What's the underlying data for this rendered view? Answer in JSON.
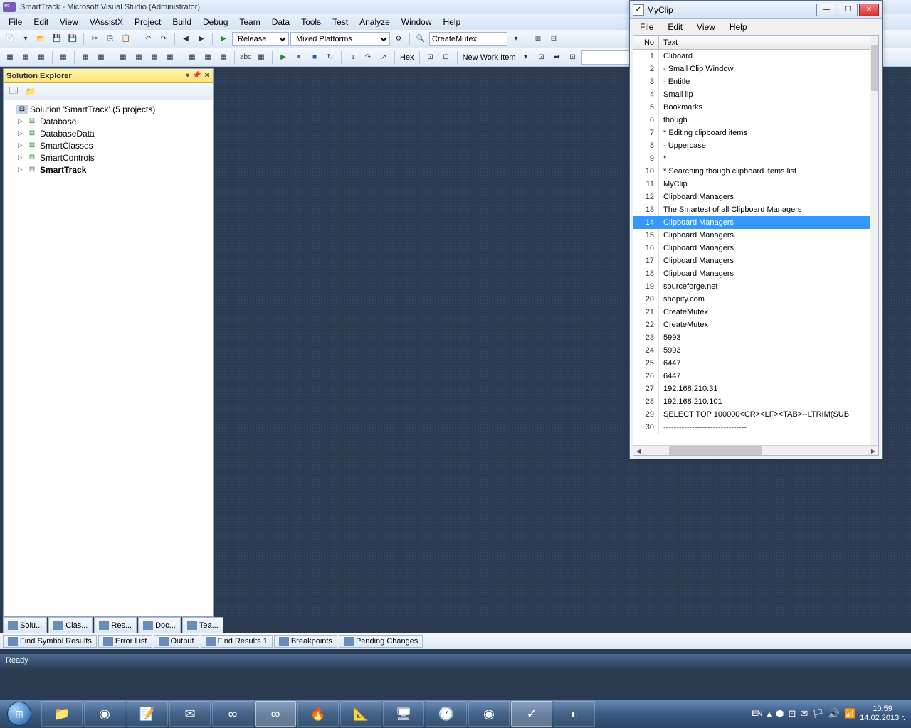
{
  "vs": {
    "title": "SmartTrack - Microsoft Visual Studio (Administrator)",
    "menu": [
      "File",
      "Edit",
      "View",
      "VAssistX",
      "Project",
      "Build",
      "Debug",
      "Team",
      "Data",
      "Tools",
      "Test",
      "Analyze",
      "Window",
      "Help"
    ],
    "config": "Release",
    "platform": "Mixed Platforms",
    "searchbox": "CreateMutex",
    "hex": "Hex",
    "newworkitem": "New Work Item",
    "solution_panel": {
      "title": "Solution Explorer",
      "solution": "Solution 'SmartTrack' (5 projects)",
      "projects": [
        "Database",
        "DatabaseData",
        "SmartClasses",
        "SmartControls",
        "SmartTrack"
      ]
    },
    "bottom_tabs": [
      "Solu...",
      "Clas...",
      "Res...",
      "Doc...",
      "Tea..."
    ],
    "output_tabs": [
      "Find Symbol Results",
      "Error List",
      "Output",
      "Find Results 1",
      "Breakpoints",
      "Pending Changes"
    ],
    "status": "Ready"
  },
  "myclip": {
    "title": "MyClip",
    "menu": [
      "File",
      "Edit",
      "View",
      "Help"
    ],
    "columns": {
      "no": "No",
      "text": "Text"
    },
    "selected": 14,
    "rows": [
      {
        "n": 1,
        "t": "Cliboard"
      },
      {
        "n": 2,
        "t": "  - Small Clip Window"
      },
      {
        "n": 3,
        "t": "  - Entitle"
      },
      {
        "n": 4,
        "t": "Small lip"
      },
      {
        "n": 5,
        "t": "Bookmarks"
      },
      {
        "n": 6,
        "t": "though"
      },
      {
        "n": 7,
        "t": "* Editing clipboard items"
      },
      {
        "n": 8,
        "t": "  - Uppercase"
      },
      {
        "n": 9,
        "t": "*"
      },
      {
        "n": 10,
        "t": "* Searching though clipboard items list"
      },
      {
        "n": 11,
        "t": "MyClip"
      },
      {
        "n": 12,
        "t": "Clipboard Managers"
      },
      {
        "n": 13,
        "t": "The Smartest of all Clipboard Managers"
      },
      {
        "n": 14,
        "t": "Clipboard Managers"
      },
      {
        "n": 15,
        "t": "Clipboard Managers"
      },
      {
        "n": 16,
        "t": "Clipboard Managers"
      },
      {
        "n": 17,
        "t": "Clipboard Managers"
      },
      {
        "n": 18,
        "t": "Clipboard Managers"
      },
      {
        "n": 19,
        "t": "sourceforge.net"
      },
      {
        "n": 20,
        "t": "shopify.com"
      },
      {
        "n": 21,
        "t": "CreateMutex"
      },
      {
        "n": 22,
        "t": "CreateMutex"
      },
      {
        "n": 23,
        "t": "5993"
      },
      {
        "n": 24,
        "t": "5993"
      },
      {
        "n": 25,
        "t": "6447"
      },
      {
        "n": 26,
        "t": "6447"
      },
      {
        "n": 27,
        "t": "192.168.210.31"
      },
      {
        "n": 28,
        "t": "192.168.210.101"
      },
      {
        "n": 29,
        "t": "SELECT TOP 100000<CR><LF><TAB>--LTRIM(SUB"
      },
      {
        "n": 30,
        "t": "--------------------------------"
      }
    ]
  },
  "taskbar": {
    "lang": "EN",
    "time": "10:59",
    "date": "14.02.2013 г."
  }
}
